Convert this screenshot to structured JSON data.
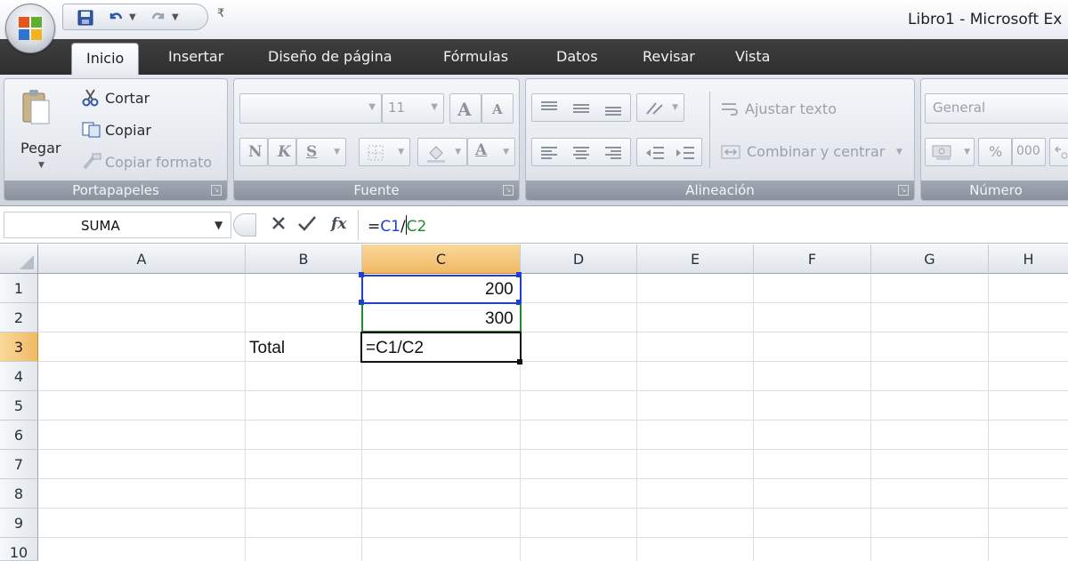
{
  "window": {
    "title": "Libro1 - Microsoft Ex"
  },
  "qat": {
    "more_glyph": "₹"
  },
  "tabs": [
    {
      "label": "Inicio",
      "active": true
    },
    {
      "label": "Insertar"
    },
    {
      "label": "Diseño de página"
    },
    {
      "label": "Fórmulas"
    },
    {
      "label": "Datos"
    },
    {
      "label": "Revisar"
    },
    {
      "label": "Vista"
    }
  ],
  "ribbon": {
    "clipboard": {
      "label": "Portapapeles",
      "paste": "Pegar",
      "cut": "Cortar",
      "copy": "Copiar",
      "format_painter": "Copiar formato"
    },
    "font": {
      "label": "Fuente",
      "size": "11",
      "grow": "A",
      "shrink": "A",
      "bold": "N",
      "italic": "K",
      "underline": "S",
      "font_color": "A"
    },
    "alignment": {
      "label": "Alineación",
      "wrap_text": "Ajustar texto",
      "merge_center": "Combinar y centrar"
    },
    "number": {
      "label": "Número",
      "format": "General",
      "percent": "%",
      "thousands": "000"
    }
  },
  "formula_bar": {
    "name_box": "SUMA",
    "formula_parts": [
      {
        "text": "=",
        "color": "#111111"
      },
      {
        "text": "C1",
        "color": "#1f3fd1"
      },
      {
        "text": "/",
        "color": "#111111"
      },
      {
        "text": "C2",
        "color": "#1d8c2e"
      }
    ]
  },
  "sheet": {
    "columns": [
      "A",
      "B",
      "C",
      "D",
      "E",
      "F",
      "G",
      "H"
    ],
    "rows": [
      "1",
      "2",
      "3",
      "4",
      "5",
      "6",
      "7",
      "8",
      "9",
      "10"
    ],
    "selected_column": "C",
    "selected_row": "3",
    "cells": {
      "C1": "200",
      "C2": "300",
      "B3": "Total",
      "C3": "=C1/C2"
    }
  },
  "colors": {
    "ref1": "#1f3fd1",
    "ref2": "#1d8c2e",
    "selected_header": "#f1b964"
  }
}
